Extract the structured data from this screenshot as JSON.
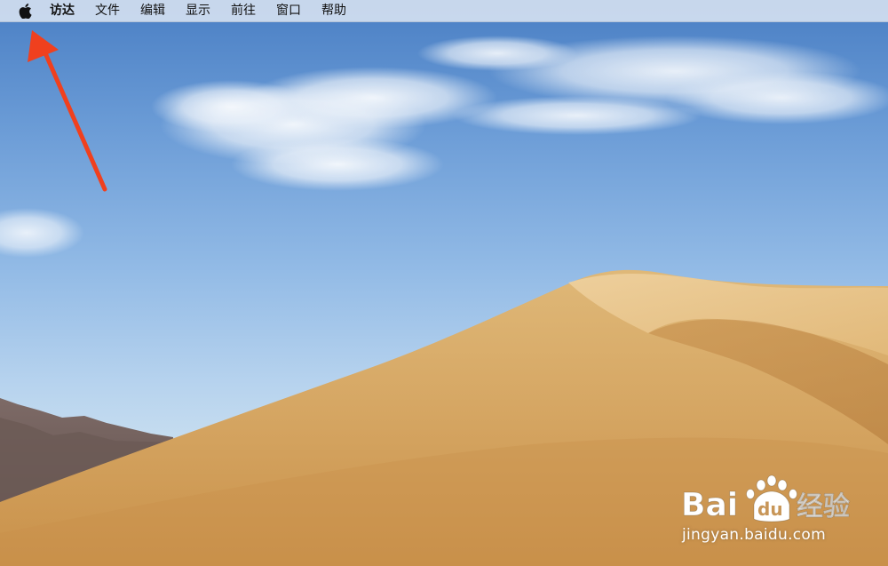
{
  "menubar": {
    "apple_icon": "apple-logo-icon",
    "items": [
      {
        "label": "访达",
        "active": true
      },
      {
        "label": "文件"
      },
      {
        "label": "编辑"
      },
      {
        "label": "显示"
      },
      {
        "label": "前往"
      },
      {
        "label": "窗口"
      },
      {
        "label": "帮助"
      }
    ]
  },
  "annotation": {
    "icon": "arrow-icon",
    "color": "#f0401e"
  },
  "watermark": {
    "logo_text": "Bai du 经验",
    "url": "jingyan.baidu.com"
  },
  "colors": {
    "sky": "#6a9bd6",
    "sand": "#d9a968"
  }
}
